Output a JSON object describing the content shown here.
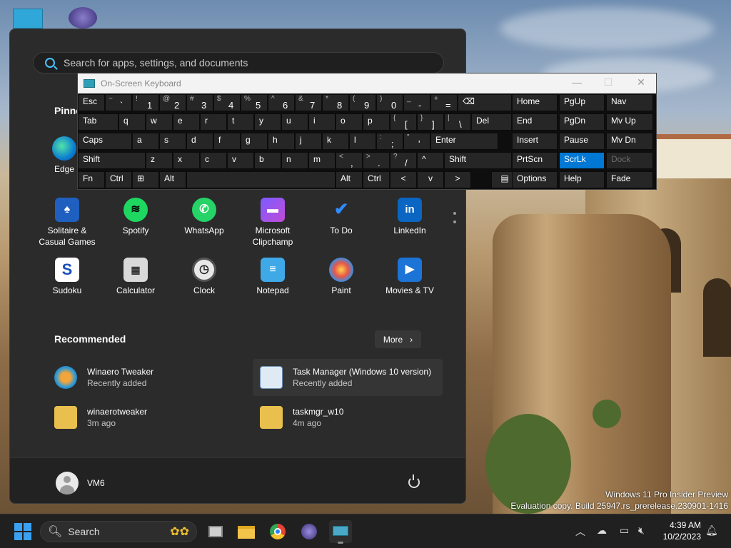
{
  "start_menu": {
    "search_placeholder": "Search for apps, settings, and documents",
    "pinned_title": "Pinned",
    "edge_label": "Edge",
    "apps": [
      {
        "label": "Solitaire &\nCasual Games",
        "icon": "cards-icon"
      },
      {
        "label": "Spotify",
        "icon": "spotify-icon"
      },
      {
        "label": "WhatsApp",
        "icon": "whatsapp-icon"
      },
      {
        "label": "Microsoft\nClipchamp",
        "icon": "clipchamp-icon"
      },
      {
        "label": "To Do",
        "icon": "checkmark-icon"
      },
      {
        "label": "LinkedIn",
        "icon": "linkedin-icon"
      },
      {
        "label": "Sudoku",
        "icon": "sudoku-icon"
      },
      {
        "label": "Calculator",
        "icon": "calculator-icon"
      },
      {
        "label": "Clock",
        "icon": "clock-icon"
      },
      {
        "label": "Notepad",
        "icon": "notepad-icon"
      },
      {
        "label": "Paint",
        "icon": "paint-palette-icon"
      },
      {
        "label": "Movies & TV",
        "icon": "play-icon"
      }
    ],
    "recommended_title": "Recommended",
    "more_label": "More",
    "recommended": [
      {
        "name": "Winaero Tweaker",
        "detail": "Recently added"
      },
      {
        "name": "Task Manager (Windows 10 version)",
        "detail": "Recently added"
      },
      {
        "name": "winaerotweaker",
        "detail": "3m ago"
      },
      {
        "name": "taskmgr_w10",
        "detail": "4m ago"
      }
    ],
    "user_name": "VM6"
  },
  "osk": {
    "title": "On-Screen Keyboard",
    "row1": [
      {
        "label": "Esc"
      },
      {
        "shift": "~",
        "main": "`"
      },
      {
        "shift": "!",
        "main": "1"
      },
      {
        "shift": "@",
        "main": "2"
      },
      {
        "shift": "#",
        "main": "3"
      },
      {
        "shift": "$",
        "main": "4"
      },
      {
        "shift": "%",
        "main": "5"
      },
      {
        "shift": "^",
        "main": "6"
      },
      {
        "shift": "&",
        "main": "7"
      },
      {
        "shift": "*",
        "main": "8"
      },
      {
        "shift": "(",
        "main": "9"
      },
      {
        "shift": ")",
        "main": "0"
      },
      {
        "shift": "_",
        "main": "-"
      },
      {
        "shift": "+",
        "main": "="
      },
      {
        "label": "⌫"
      }
    ],
    "row2": [
      "Tab",
      "q",
      "w",
      "e",
      "r",
      "t",
      "y",
      "u",
      "i",
      "o",
      "p",
      "[",
      "]",
      "\\",
      "Del"
    ],
    "row2_shift": {
      "11": "{",
      "12": "}",
      "13": "|"
    },
    "row3": [
      "Caps",
      "a",
      "s",
      "d",
      "f",
      "g",
      "h",
      "j",
      "k",
      "l",
      ";",
      "'",
      "Enter"
    ],
    "row3_shift": {
      "10": ":",
      "11": "\""
    },
    "row4": [
      "Shift",
      "z",
      "x",
      "c",
      "v",
      "b",
      "n",
      "m",
      ",",
      ".",
      "/",
      "^",
      "Shift"
    ],
    "row4_shift": {
      "8": "<",
      "9": ">",
      "10": "?"
    },
    "row5": [
      "Fn",
      "Ctrl",
      "⊞",
      "Alt",
      "",
      "Alt",
      "Ctrl",
      "<",
      "v",
      ">",
      "▤"
    ],
    "nav": [
      [
        "Home",
        "PgUp",
        "Nav"
      ],
      [
        "End",
        "PgDn",
        "Mv Up"
      ],
      [
        "Insert",
        "Pause",
        "Mv Dn"
      ],
      [
        "PrtScn",
        "ScrLk",
        "Dock"
      ],
      [
        "Options",
        "Help",
        "Fade"
      ]
    ]
  },
  "taskbar": {
    "search_label": "Search",
    "time": "4:39 AM",
    "date": "10/2/2023"
  },
  "watermark": {
    "line1": "Windows 11 Pro Insider Preview",
    "line2": "Evaluation copy. Build 25947.rs_prerelease.230901-1416"
  },
  "colors": {
    "accent": "#0078d4",
    "start_bg": "#2b2b2b",
    "taskbar_bg": "#202020"
  }
}
